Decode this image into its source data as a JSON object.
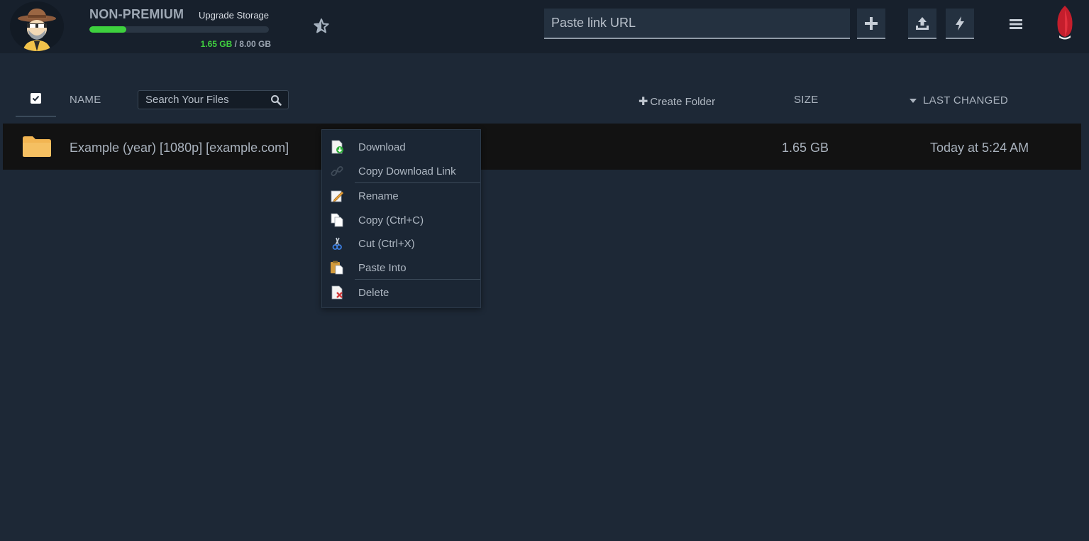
{
  "account": {
    "plan": "NON-PREMIUM",
    "upgrade_label": "Upgrade Storage",
    "storage_used": "1.65 GB",
    "storage_sep": " / ",
    "storage_total": "8.00 GB",
    "storage_fraction": 0.206,
    "storage_color": "#3ed13e"
  },
  "toolbar": {
    "url_placeholder": "Paste link URL",
    "add_icon": "plus-icon",
    "upload_icon": "upload-icon",
    "flash_icon": "lightning-icon",
    "menu_icon": "hamburger-icon",
    "logo_icon": "red-feather-logo"
  },
  "list_header": {
    "name_label": "NAME",
    "search_placeholder": "Search Your Files",
    "create_folder_label": "Create Folder",
    "size_label": "SIZE",
    "last_changed_label": "LAST CHANGED"
  },
  "files": [
    {
      "name": "Example (year) [1080p] [example.com]",
      "size": "1.65 GB",
      "changed": "Today at 5:24 AM",
      "type": "folder"
    }
  ],
  "context_menu": {
    "items": [
      {
        "label": "Download",
        "icon": "download-icon",
        "enabled": true
      },
      {
        "label": "Copy Download Link",
        "icon": "link-icon",
        "enabled": false
      },
      {
        "label": "Rename",
        "icon": "rename-icon",
        "enabled": true
      },
      {
        "label": "Copy (Ctrl+C)",
        "icon": "copy-icon",
        "enabled": true
      },
      {
        "label": "Cut (Ctrl+X)",
        "icon": "scissors-icon",
        "enabled": true
      },
      {
        "label": "Paste Into",
        "icon": "paste-icon",
        "enabled": true
      },
      {
        "label": "Delete",
        "icon": "delete-icon",
        "enabled": true
      }
    ]
  },
  "colors": {
    "background": "#1d2836",
    "topbar": "#17202c",
    "row_selected": "#121212",
    "folder": "#f2b552",
    "accent_red": "#d1202f"
  }
}
